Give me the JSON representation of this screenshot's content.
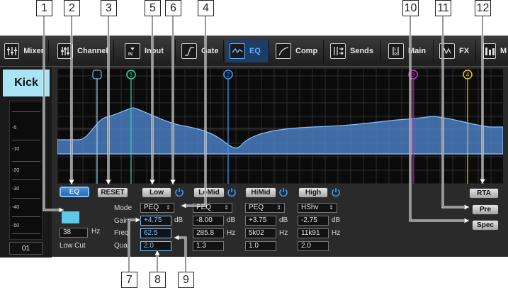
{
  "callouts": {
    "c1": "1",
    "c2": "2",
    "c3": "3",
    "c4": "4",
    "c5": "5",
    "c6": "6",
    "c7": "7",
    "c8": "8",
    "c9": "9",
    "c10": "10",
    "c11": "11",
    "c12": "12"
  },
  "tabs": [
    {
      "label": "Mixer",
      "icon": "mixer-icon"
    },
    {
      "label": "Channel",
      "icon": "channel-icon"
    },
    {
      "label": "Input",
      "icon": "input-icon"
    },
    {
      "label": "Gate",
      "icon": "gate-icon"
    },
    {
      "label": "EQ",
      "icon": "eq-icon",
      "active": true
    },
    {
      "label": "Comp",
      "icon": "comp-icon"
    },
    {
      "label": "Sends",
      "icon": "sends-icon"
    },
    {
      "label": "Main",
      "icon": "main-icon"
    },
    {
      "label": "FX",
      "icon": "fx-icon"
    },
    {
      "label": "M",
      "icon": "meters-icon"
    }
  ],
  "channel": {
    "name": "Kick",
    "number": "01",
    "meter_labels": [
      "-5",
      "-10",
      "-20",
      "-30",
      "-40",
      "-50"
    ]
  },
  "lowcut": {
    "freq": "38",
    "unit": "Hz",
    "label": "Low Cut"
  },
  "eq_buttons": {
    "eq": "EQ",
    "reset": "RESET",
    "rta": "RTA",
    "pre": "Pre",
    "spec": "Spec"
  },
  "field_labels": {
    "mode": "Mode",
    "gain": "Gain",
    "freq": "Freq",
    "quality": "Qual"
  },
  "bands": [
    {
      "name": "Low",
      "mode": "PEQ",
      "gain": "+4.75",
      "freq": "62.5",
      "q": "2.0",
      "freq_unit": "Hz",
      "handle": "1"
    },
    {
      "name": "LoMid",
      "mode": "PEQ",
      "gain": "-8.00",
      "freq": "285.8",
      "q": "1.3",
      "freq_unit": "Hz",
      "handle": "2"
    },
    {
      "name": "HiMid",
      "mode": "PEQ",
      "gain": "+3.75",
      "freq": "5k02",
      "q": "1.0",
      "freq_unit": "Hz",
      "handle": "3"
    },
    {
      "name": "High",
      "mode": "HShv",
      "gain": "-2.75",
      "freq": "11k91",
      "q": "2.0",
      "freq_unit": "Hz",
      "handle": "4"
    }
  ],
  "gain_unit": "dB",
  "colors": {
    "accent": "#5fb0ff",
    "band1": "#2fd9b0",
    "band2": "#3da0ff",
    "band3": "#cc33cc",
    "band4": "#e6c21a",
    "curve_fill": "#4a7cc0",
    "lowcut_marker": "#9ad6f0"
  }
}
